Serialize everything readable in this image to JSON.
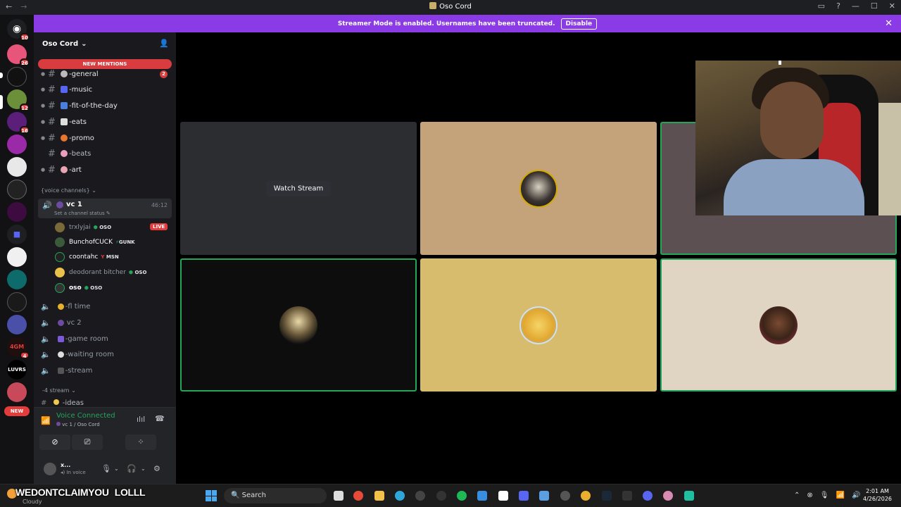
{
  "window": {
    "title": "Oso Cord"
  },
  "banner": {
    "text": "Streamer Mode is enabled. Usernames have been truncated.",
    "disable_label": "Disable"
  },
  "server": {
    "name": "Oso Cord"
  },
  "server_badges": {
    "top": "10",
    "s2": "26",
    "s4": "12",
    "s5": "16",
    "s_new": "NEW",
    "s4gm": "4"
  },
  "new_mentions": "NEW MENTIONS",
  "text_channels": [
    {
      "label": "-general",
      "mention": "2"
    },
    {
      "label": "-music"
    },
    {
      "label": "-fit-of-the-day"
    },
    {
      "label": "-eats"
    },
    {
      "label": "-promo"
    },
    {
      "label": "-beats"
    },
    {
      "label": "-art"
    }
  ],
  "voice_category": "{voice channels} ⌄",
  "vc1": {
    "name": "vc 1",
    "status": "Set a channel status ✎",
    "timer": "46:12"
  },
  "members": [
    {
      "name": "trxlyjai",
      "tag": "OSO",
      "live": "LIVE"
    },
    {
      "name": "BunchofCUCK",
      "tag": "GUNK"
    },
    {
      "name": "coontahc",
      "tag": "MSN"
    },
    {
      "name": "deodorant bitcher",
      "tag": "OSO"
    },
    {
      "name": "oso",
      "tag": "OSO"
    }
  ],
  "voice_channels": [
    "-fl time",
    "vc 2",
    "-game room",
    "-waiting room",
    "-stream"
  ],
  "stream_category": "-4 stream ⌄",
  "ideas_channel": "-ideas",
  "voice_panel": {
    "title": "Voice Connected",
    "sub": "vc 1 / Oso Cord"
  },
  "user_panel": {
    "name": "x...",
    "status": "In voice"
  },
  "stage": {
    "watch_stream": "Watch Stream"
  },
  "overlay": {
    "left": "WEDONTCLAIMYOU",
    "right": "LOLLL"
  },
  "taskbar": {
    "weather_desc": "Cloudy",
    "search_placeholder": "Search",
    "time": "2:01 AM",
    "date": "4/26/2026"
  },
  "colors": {
    "accent_banner": "#8a3be6",
    "speaking": "#23a55a",
    "mention": "#d83c3e"
  }
}
